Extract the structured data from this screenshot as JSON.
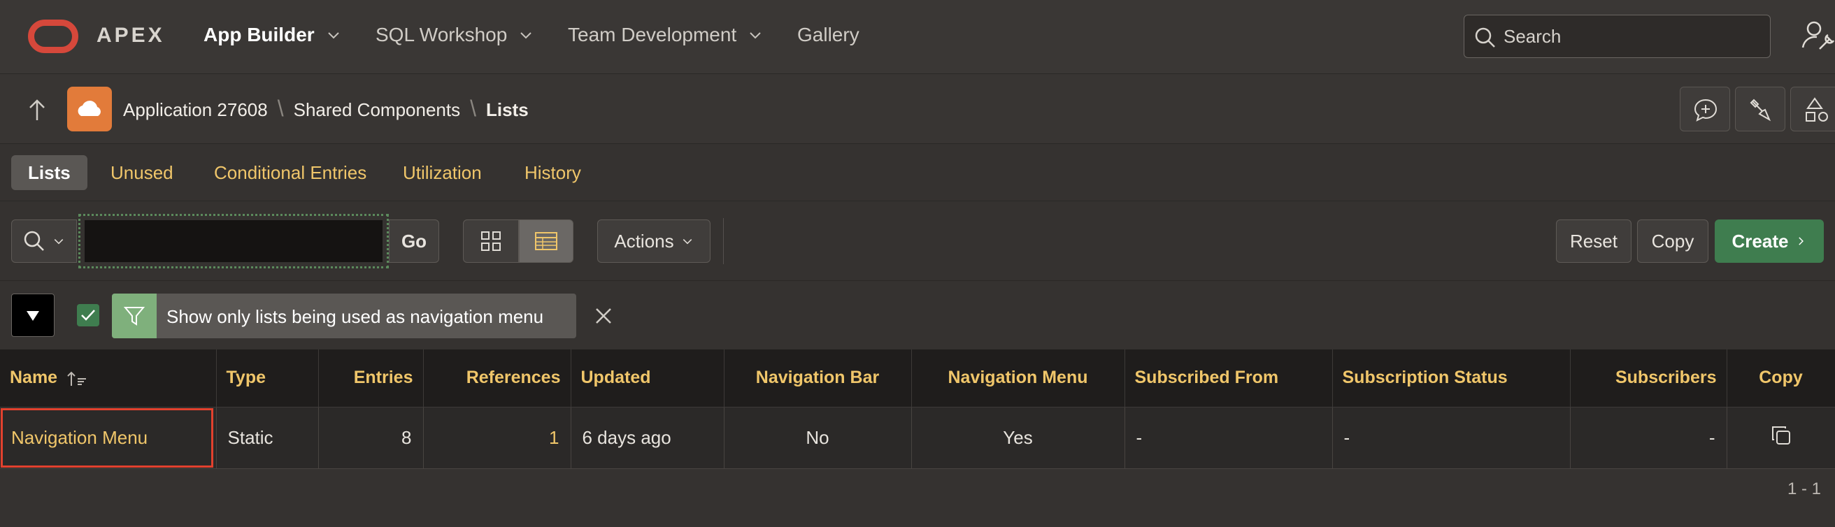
{
  "header": {
    "brand": "APEX",
    "nav": [
      {
        "label": "App Builder",
        "active": true
      },
      {
        "label": "SQL Workshop",
        "active": false
      },
      {
        "label": "Team Development",
        "active": false
      },
      {
        "label": "Gallery",
        "active": false
      }
    ],
    "search_placeholder": "Search"
  },
  "breadcrumb": {
    "items": [
      "Application 27608",
      "Shared Components",
      "Lists"
    ]
  },
  "tabs": [
    "Lists",
    "Unused",
    "Conditional Entries",
    "Utilization",
    "History"
  ],
  "toolbar": {
    "go_label": "Go",
    "actions_label": "Actions",
    "reset_label": "Reset",
    "copy_label": "Copy",
    "create_label": "Create",
    "search_value": ""
  },
  "filter": {
    "text": "Show only lists being used as navigation menu",
    "checked": true
  },
  "table": {
    "columns": [
      "Name",
      "Type",
      "Entries",
      "References",
      "Updated",
      "Navigation Bar",
      "Navigation Menu",
      "Subscribed From",
      "Subscription Status",
      "Subscribers",
      "Copy"
    ],
    "rows": [
      {
        "name": "Navigation Menu",
        "type": "Static",
        "entries": "8",
        "references": "1",
        "updated": "6 days ago",
        "navigation_bar": "No",
        "navigation_menu": "Yes",
        "subscribed_from": "-",
        "subscription_status": "-",
        "subscribers": "-"
      }
    ]
  },
  "pagination": "1 - 1",
  "colors": {
    "accent_link": "#f0c66a",
    "create_green": "#3f7d4f",
    "logo_red": "#d6483b",
    "highlight_red": "#e2412e"
  }
}
